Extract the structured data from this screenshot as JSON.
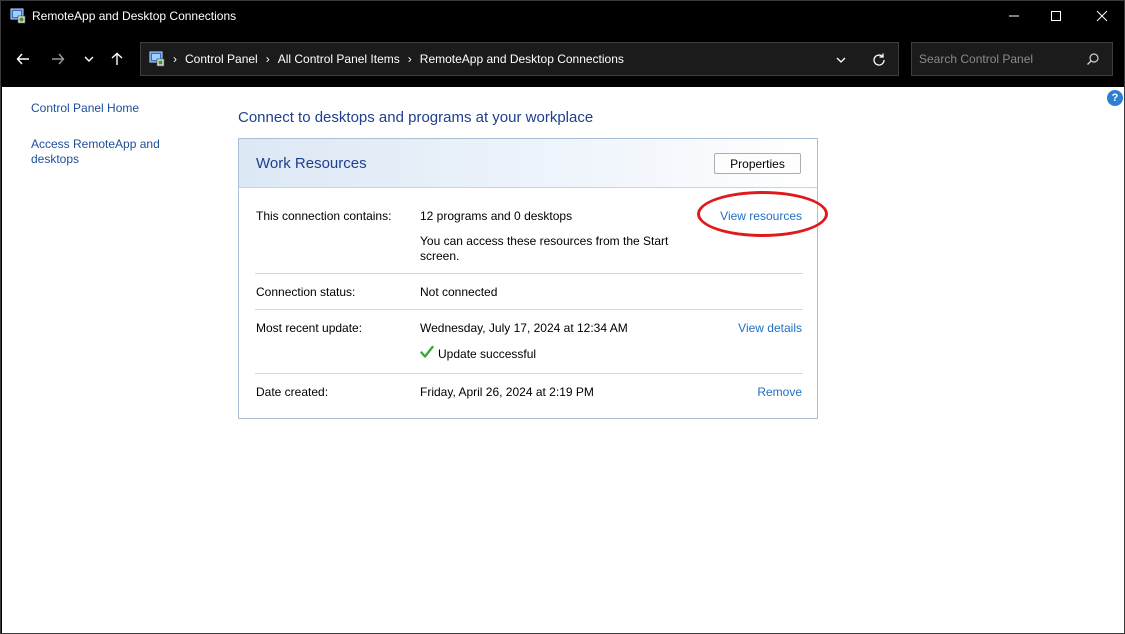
{
  "window": {
    "title": "RemoteApp and Desktop Connections",
    "icon": "remoteapp-icon",
    "controls": [
      "minimize-icon",
      "maximize-icon",
      "close-icon"
    ]
  },
  "nav": {
    "buttons": [
      "back-arrow-icon",
      "forward-arrow-icon",
      "recent-dropdown-icon",
      "up-arrow-icon"
    ],
    "breadcrumbs": [
      "Control Panel",
      "All Control Panel Items",
      "RemoteApp and Desktop Connections"
    ],
    "search_placeholder": "Search Control Panel"
  },
  "sidebar": {
    "items": [
      {
        "label": "Control Panel Home"
      },
      {
        "label": "Access RemoteApp and desktops"
      }
    ]
  },
  "main": {
    "heading": "Connect to desktops and programs at your workplace",
    "panel": {
      "title": "Work Resources",
      "properties_label": "Properties",
      "rows": [
        {
          "label": "This connection contains:",
          "value": "12 programs and 0 desktops",
          "note": "You can access these resources from the Start screen.",
          "link": "View resources"
        },
        {
          "label": "Connection status:",
          "value": "Not connected"
        },
        {
          "label": "Most recent update:",
          "value": "Wednesday, July 17, 2024 at 12:34 AM",
          "status": "Update successful",
          "link": "View details"
        },
        {
          "label": "Date created:",
          "value": "Friday, April 26, 2024 at 2:19 PM",
          "link": "Remove"
        }
      ]
    }
  },
  "colors": {
    "link": "#1e6fc4",
    "heading": "#1e3f8f",
    "highlight": "#e01a1a",
    "success": "#3aa83a"
  }
}
